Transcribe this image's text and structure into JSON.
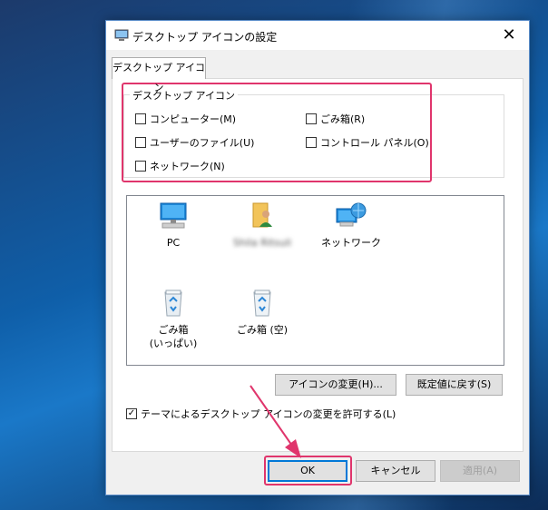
{
  "dialog": {
    "title": "デスクトップ アイコンの設定",
    "close_glyph": "✕"
  },
  "tab": {
    "label": "デスクトップ アイコン"
  },
  "group": {
    "title": "デスクトップ アイコン",
    "checkboxes": [
      {
        "label": "コンピューター(M)",
        "checked": false
      },
      {
        "label": "ごみ箱(R)",
        "checked": false
      },
      {
        "label": "ユーザーのファイル(U)",
        "checked": false
      },
      {
        "label": "コントロール パネル(O)",
        "checked": false
      },
      {
        "label": "ネットワーク(N)",
        "checked": false
      }
    ]
  },
  "icons": [
    {
      "label": "PC",
      "icon": "pc-icon"
    },
    {
      "label": "Shila Ritsuli",
      "icon": "user-folder-icon",
      "blurred": true
    },
    {
      "label": "ネットワーク",
      "icon": "network-icon"
    },
    {
      "label": "ごみ箱\n(いっぱい)",
      "label_line1": "ごみ箱",
      "label_line2": "(いっぱい)",
      "icon": "recycle-bin-full-icon"
    },
    {
      "label": "ごみ箱 (空)",
      "icon": "recycle-bin-empty-icon"
    }
  ],
  "buttons": {
    "change_icon": "アイコンの変更(H)...",
    "restore_default": "既定値に戻す(S)",
    "ok": "OK",
    "cancel": "キャンセル",
    "apply": "適用(A)"
  },
  "theme_checkbox": {
    "label": "テーマによるデスクトップ アイコンの変更を許可する(L)",
    "checked": true
  },
  "colors": {
    "highlight": "#e0356c",
    "accent": "#0078d7"
  }
}
